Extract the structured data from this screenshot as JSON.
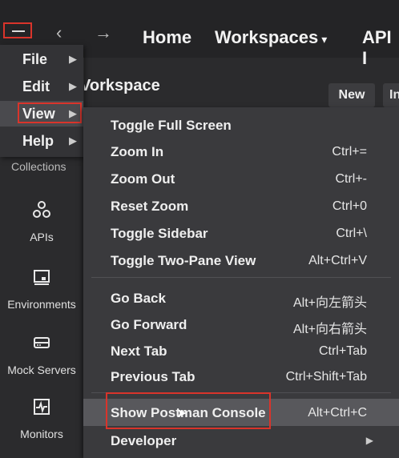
{
  "topbar": {
    "back_arrow": "‹",
    "forward_arrow": "→",
    "home": "Home",
    "workspaces": "Workspaces",
    "api": "API I"
  },
  "workspace": {
    "title": "Vorkspace",
    "new_button": "New",
    "import_button": "In"
  },
  "sidebar": {
    "collections": "Collections",
    "items": [
      {
        "label": "APIs",
        "icon": "apis-icon"
      },
      {
        "label": "Environments",
        "icon": "environments-icon"
      },
      {
        "label": "Mock Servers",
        "icon": "mock-servers-icon"
      },
      {
        "label": "Monitors",
        "icon": "monitors-icon"
      }
    ]
  },
  "app_menu": {
    "items": [
      {
        "label": "File"
      },
      {
        "label": "Edit"
      },
      {
        "label": "View"
      },
      {
        "label": "Help"
      }
    ]
  },
  "view_menu": {
    "items": [
      {
        "label": "Toggle Full Screen",
        "shortcut": ""
      },
      {
        "label": "Zoom In",
        "shortcut": "Ctrl+="
      },
      {
        "label": "Zoom Out",
        "shortcut": "Ctrl+-"
      },
      {
        "label": "Reset Zoom",
        "shortcut": "Ctrl+0"
      },
      {
        "label": "Toggle Sidebar",
        "shortcut": "Ctrl+\\"
      },
      {
        "label": "Toggle Two-Pane View",
        "shortcut": "Alt+Ctrl+V"
      },
      {
        "label": "Go Back",
        "shortcut": "Alt+向左箭头"
      },
      {
        "label": "Go Forward",
        "shortcut": "Alt+向右箭头"
      },
      {
        "label": "Next Tab",
        "shortcut": "Ctrl+Tab"
      },
      {
        "label": "Previous Tab",
        "shortcut": "Ctrl+Shift+Tab"
      },
      {
        "label": "Show Postman Console",
        "shortcut": "Alt+Ctrl+C"
      },
      {
        "label": "Developer",
        "shortcut": ""
      }
    ]
  },
  "colors": {
    "highlight_box": "#d9342b",
    "menu_bg": "#3a3a3d"
  }
}
